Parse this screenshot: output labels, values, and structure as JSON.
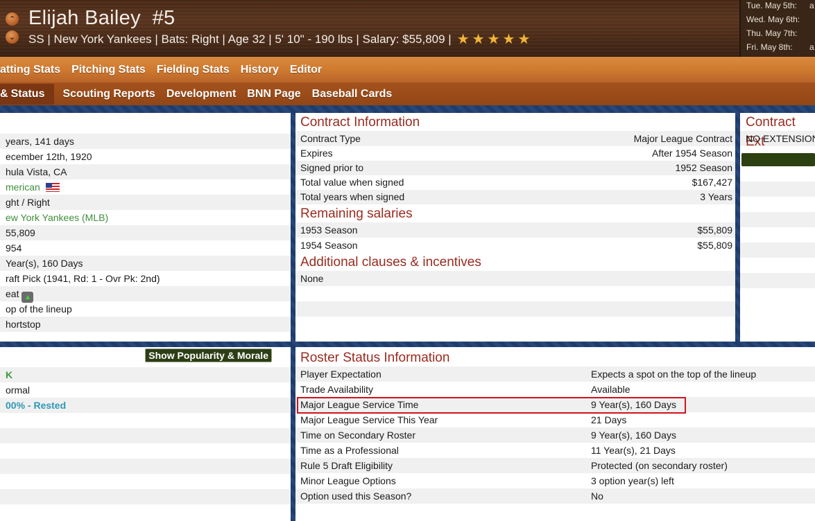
{
  "header": {
    "name": "Elijah Bailey",
    "number": "#5",
    "meta": "SS | New York Yankees  |  Bats: Right  |  Age 32  |  5' 10\" - 190 lbs  |  Salary: $55,809  |",
    "stars": 5,
    "up_icon": "chevron-up-icon",
    "down_icon": "chevron-down-icon"
  },
  "schedule": [
    {
      "day": "Tue. May 5th:",
      "opp": "a"
    },
    {
      "day": "Wed. May 6th:",
      "opp": ""
    },
    {
      "day": "Thu. May 7th:",
      "opp": ""
    },
    {
      "day": "Fri. May 8th:",
      "opp": "a"
    }
  ],
  "nav_primary": [
    "atting Stats",
    "Pitching Stats",
    "Fielding Stats",
    "History",
    "Editor"
  ],
  "nav_secondary": [
    "Status",
    "Scouting Reports",
    "Development",
    "BNN Page",
    "Baseball Cards"
  ],
  "bio_values": [
    " years, 141 days",
    "ecember 12th, 1920",
    "hula Vista, CA",
    "merican",
    "ght / Right",
    "ew York Yankees (MLB)",
    "55,809",
    "954",
    "Year(s), 160 Days",
    "raft Pick (1941, Rd: 1 - Ovr Pk: 2nd)",
    "eat",
    "op of the lineup",
    "hortstop"
  ],
  "contract": {
    "title": "Contract Information",
    "rows": [
      {
        "label": "Contract Type",
        "value": "Major League Contract"
      },
      {
        "label": "Expires",
        "value": "After 1954 Season"
      },
      {
        "label": "Signed prior to",
        "value": "1952 Season"
      },
      {
        "label": "Total value when signed",
        "value": "$167,427"
      },
      {
        "label": "Total years when signed",
        "value": "3 Years"
      }
    ],
    "remaining_title": "Remaining salaries",
    "remaining": [
      {
        "label": "1953 Season",
        "value": "$55,809"
      },
      {
        "label": "1954 Season",
        "value": "$55,809"
      }
    ],
    "clauses_title": "Additional clauses & incentives",
    "clauses": [
      "None"
    ]
  },
  "extension": {
    "title": "Contract Ext",
    "status": "NO EXTENSION"
  },
  "morale": {
    "button": "Show Popularity & Morale",
    "values": [
      "K",
      "ormal",
      "00% - Rested"
    ]
  },
  "roster": {
    "title": "Roster Status Information",
    "rows": [
      {
        "label": "Player Expectation",
        "value": "Expects a spot on the top of the lineup"
      },
      {
        "label": "Trade Availability",
        "value": "Available"
      },
      {
        "label": "Major League Service Time",
        "value": "9 Year(s), 160 Days"
      },
      {
        "label": "Major League Service This Year",
        "value": "21 Days"
      },
      {
        "label": "Time on Secondary Roster",
        "value": "9 Year(s), 160 Days"
      },
      {
        "label": "Time as a Professional",
        "value": "11 Year(s), 21 Days"
      },
      {
        "label": "Rule 5 Draft Eligibility",
        "value": "Protected (on secondary roster)"
      },
      {
        "label": "Minor League Options",
        "value": "3 option year(s) left"
      },
      {
        "label": "Option used this Season?",
        "value": "No"
      }
    ]
  }
}
